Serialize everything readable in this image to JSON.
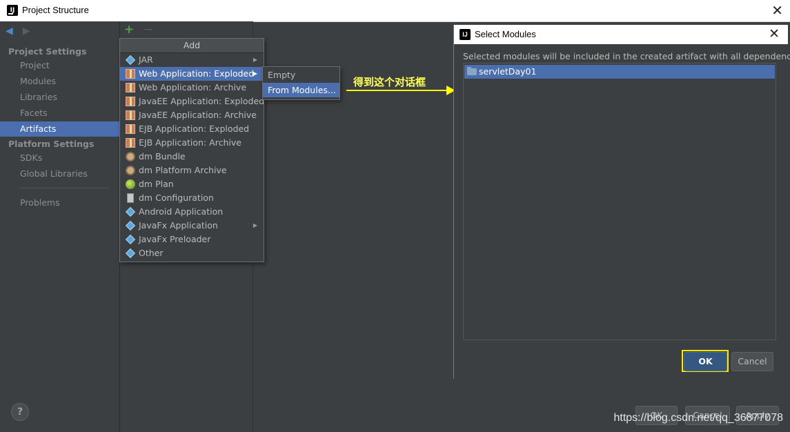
{
  "window": {
    "title": "Project Structure",
    "app_icon": "IJ"
  },
  "leftnav": {
    "section_project": "Project Settings",
    "project_items": [
      "Project",
      "Modules",
      "Libraries",
      "Facets",
      "Artifacts"
    ],
    "section_platform": "Platform Settings",
    "platform_items": [
      "SDKs",
      "Global Libraries"
    ],
    "problems": "Problems"
  },
  "toolbar": {
    "add": "+",
    "remove": "−"
  },
  "add_menu": {
    "header": "Add",
    "items": [
      {
        "label": "JAR",
        "icon": "diamond-icon"
      },
      {
        "label": "Web Application: Exploded",
        "icon": "web-archive-icon"
      },
      {
        "label": "Web Application: Archive",
        "icon": "web-archive-icon"
      },
      {
        "label": "JavaEE Application: Exploded",
        "icon": "javaee-archive-icon"
      },
      {
        "label": "JavaEE Application: Archive",
        "icon": "javaee-archive-icon"
      },
      {
        "label": "EJB Application: Exploded",
        "icon": "ejb-archive-icon"
      },
      {
        "label": "EJB Application: Archive",
        "icon": "ejb-archive-icon"
      },
      {
        "label": "dm Bundle",
        "icon": "bundle-icon"
      },
      {
        "label": "dm Platform Archive",
        "icon": "bundle-icon"
      },
      {
        "label": "dm Plan",
        "icon": "globe-icon"
      },
      {
        "label": "dm Configuration",
        "icon": "document-icon"
      },
      {
        "label": "Android Application",
        "icon": "diamond-icon"
      },
      {
        "label": "JavaFx Application",
        "icon": "diamond-icon"
      },
      {
        "label": "JavaFx Preloader",
        "icon": "diamond-icon"
      },
      {
        "label": "Other",
        "icon": "diamond-icon"
      }
    ]
  },
  "submenu": {
    "items": [
      "Empty",
      "From Modules..."
    ]
  },
  "annotation": {
    "text": "得到这个对话框",
    "color": "#ffff00"
  },
  "dialog": {
    "title": "Select Modules",
    "description": "Selected modules will be included in the created artifact with all dependencies",
    "modules": [
      "servletDay01"
    ],
    "ok_label": "OK",
    "cancel_label": "Cancel"
  },
  "background_buttons": {
    "ok": "OK",
    "cancel": "Cancel",
    "apply": "Apply"
  },
  "help": "?",
  "watermark": "https://blog.csdn.net/qq_36877078",
  "colors": {
    "selection": "#4b6eaf",
    "background": "#3c3f41",
    "highlight": "#ffea00"
  }
}
